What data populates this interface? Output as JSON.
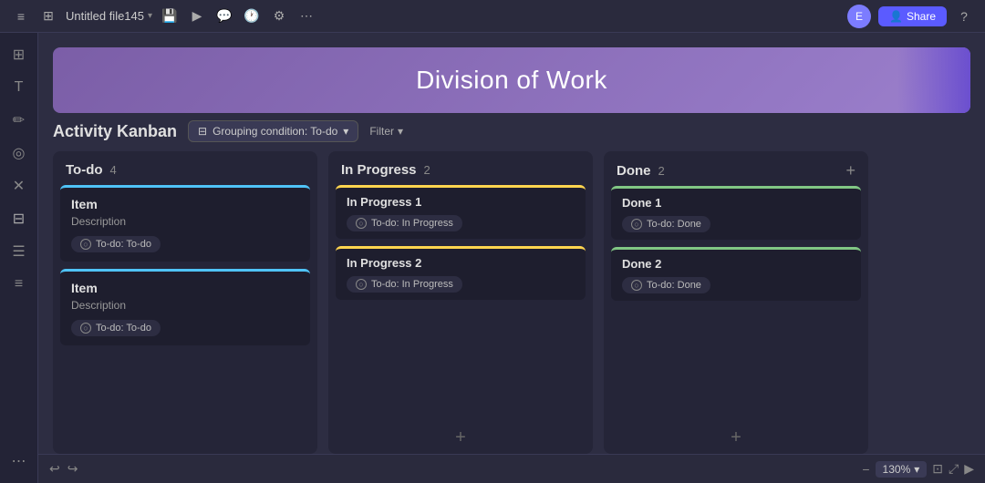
{
  "toolbar": {
    "file_name": "Untitled file145",
    "chevron": "▾",
    "icons": [
      "≡",
      "⊞",
      "⟳"
    ],
    "share_label": "Share",
    "avatar_initials": "E"
  },
  "banner": {
    "title": "Division of Work"
  },
  "kanban": {
    "title": "Activity Kanban",
    "grouping_label": "Grouping condition: To-do",
    "filter_label": "Filter",
    "columns": [
      {
        "id": "todo",
        "title": "To-do",
        "count": "4",
        "color": "blue",
        "cards": [
          {
            "title": "Item",
            "description": "Description",
            "tag": "To-do: To-do",
            "color": "blue-top"
          },
          {
            "title": "Item",
            "description": "Description",
            "tag": "To-do: To-do",
            "color": "blue-top"
          }
        ]
      },
      {
        "id": "in-progress",
        "title": "In Progress",
        "count": "2",
        "color": "yellow",
        "cards": [
          {
            "title": "In Progress 1",
            "tag": "To-do: In Progress",
            "color": "yellow-top"
          },
          {
            "title": "In Progress 2",
            "tag": "To-do: In Progress",
            "color": "yellow-top"
          }
        ]
      },
      {
        "id": "done",
        "title": "Done",
        "count": "2",
        "color": "green",
        "cards": [
          {
            "title": "Done 1",
            "tag": "To-do: Done",
            "color": "green-top"
          },
          {
            "title": "Done 2",
            "tag": "To-do: Done",
            "color": "green-top"
          }
        ]
      }
    ]
  },
  "bottombar": {
    "zoom": "130%",
    "icons": [
      "↩",
      "↪",
      "▶"
    ]
  },
  "sidebar": {
    "icons": [
      "⊞",
      "T",
      "✏",
      "◎",
      "✕",
      "☰",
      "≡",
      "⋮",
      "…"
    ]
  }
}
